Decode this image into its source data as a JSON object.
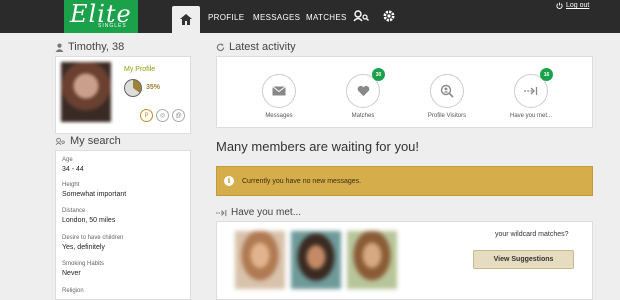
{
  "header": {
    "logo_text": "Elite",
    "logo_subtext": "SINGLES",
    "nav": [
      "PROFILE",
      "MESSAGES",
      "MATCHES"
    ],
    "logout_label": "Log out",
    "icons": [
      "home-icon",
      "search-users-icon",
      "gear-icon",
      "power-icon"
    ],
    "brand_color": "#1aa14a"
  },
  "sidebar": {
    "user_title": "Timothy, 38",
    "my_profile_label": "My Profile",
    "profile_completion": "35%",
    "search_title": "My search",
    "search_fields": [
      {
        "label": "Age",
        "value": "34 - 44"
      },
      {
        "label": "Height",
        "value": "Somewhat important"
      },
      {
        "label": "Distance",
        "value": "London, 50 miles"
      },
      {
        "label": "Desire to have children",
        "value": "Yes, definitely"
      },
      {
        "label": "Smoking Habits",
        "value": "Never"
      },
      {
        "label": "Religion",
        "value": ""
      }
    ]
  },
  "main": {
    "latest_title": "Latest activity",
    "activities": [
      {
        "label": "Messages",
        "count": ""
      },
      {
        "label": "Matches",
        "count": "30"
      },
      {
        "label": "Profile Visitors",
        "count": ""
      },
      {
        "label": "Have you met...",
        "count": "16"
      }
    ],
    "waiting_text": "Many members are waiting for you!",
    "alert_text": "Currently you have no new messages.",
    "alert_color": "#d6ad4b",
    "have_you_met_title": "Have you met...",
    "wildcard_text": "your wildcard matches?",
    "view_suggestions_label": "View Suggestions"
  }
}
